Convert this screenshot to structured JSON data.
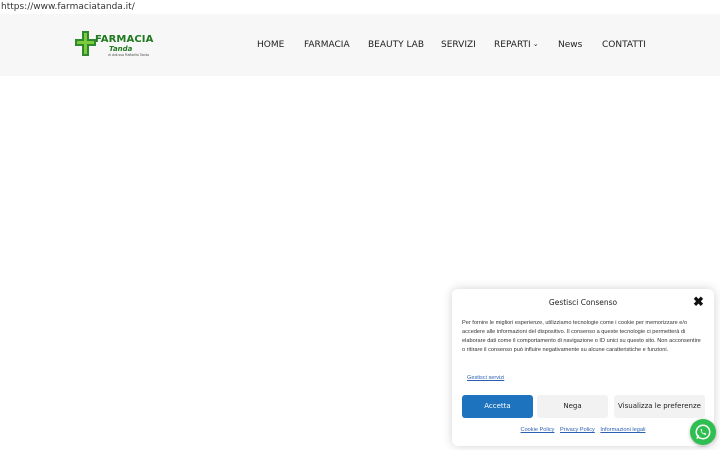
{
  "browser": {
    "url": "https://www.farmaciatanda.it/"
  },
  "logo": {
    "name": "FARMACIA",
    "subname": "Tanda",
    "tagline": "di dott.ssa Raffaella Tanda"
  },
  "nav": {
    "items": [
      {
        "label": "HOME"
      },
      {
        "label": "FARMACIA"
      },
      {
        "label": "BEAUTY LAB"
      },
      {
        "label": "SERVIZI"
      },
      {
        "label": "REPARTI"
      },
      {
        "label": "News"
      },
      {
        "label": "CONTATTI"
      }
    ],
    "reparti_chevron": "chevron-down-icon"
  },
  "consent": {
    "title": "Gestisci Consenso",
    "close_icon": "close-icon",
    "body": "Per fornire le migliori esperienze, utilizziamo tecnologie come i cookie per memorizzare e/o accedere alle informazioni del dispositivo. Il consenso a queste tecnologie ci permetterà di elaborare dati come il comportamento di navigazione o ID unici su questo sito. Non acconsentire o ritirare il consenso può influire negativamente su alcune caratteristiche e funzioni.",
    "manage_services": "Gestisci servizi",
    "accept": "Accetta",
    "deny": "Nega",
    "preferences": "Visualizza le preferenze",
    "links": [
      "Cookie Policy",
      "Privacy Policy",
      "Informazioni legali"
    ],
    "accent_color": "#1e73be"
  },
  "whatsapp": {
    "icon": "whatsapp-icon",
    "color": "#2fbf50"
  }
}
